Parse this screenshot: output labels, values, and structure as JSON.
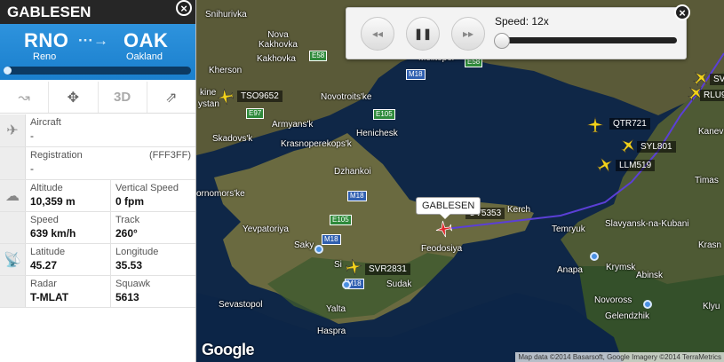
{
  "flight": {
    "callsign": "GABLESEN",
    "origin_code": "RNO",
    "origin_city": "Reno",
    "destination_code": "OAK",
    "destination_city": "Oakland",
    "progress_fraction": 0.02
  },
  "toolbar": {
    "three_d_label": "3D"
  },
  "details": {
    "aircraft_label": "Aircraft",
    "aircraft_value": "-",
    "registration_label": "Registration",
    "registration_code": "(FFF3FF)",
    "registration_value": "-",
    "altitude_label": "Altitude",
    "altitude_value": "10,359 m",
    "vspeed_label": "Vertical Speed",
    "vspeed_value": "0 fpm",
    "speed_label": "Speed",
    "speed_value": "639 km/h",
    "track_label": "Track",
    "track_value": "260°",
    "latitude_label": "Latitude",
    "latitude_value": "45.27",
    "longitude_label": "Longitude",
    "longitude_value": "35.53",
    "radar_label": "Radar",
    "radar_value": "T-MLAT",
    "squawk_label": "Squawk",
    "squawk_value": "5613"
  },
  "playback": {
    "speed_label": "Speed: 12x"
  },
  "map": {
    "callout": "GABLESEN",
    "google": "Google",
    "credit": "Map data ©2014 Basarsoft, Google Imagery ©2014 TerraMetrics",
    "places": {
      "snihurivka": "Snihurivka",
      "nova_kakhovka": "Nova\nKakhovka",
      "kakhovka": "Kakhovka",
      "kherson": "Kherson",
      "melitopol": "Melitopol'",
      "novotroitske": "Novotroits'ke",
      "armyansk": "Armyans'k",
      "henichesk": "Henichesk",
      "krasnoperekopsk": "Krasnoperekops'k",
      "skadovsk": "Skadovs'k",
      "dzhankoi": "Dzhankoi",
      "chornomorske": "ornomors'ke",
      "yevpatoriya": "Yevpatoriya",
      "saky": "Saky",
      "simferopol": "Si",
      "feodosiya": "Feodosiya",
      "sudak": "Sudak",
      "sevastopol": "Sevastopol",
      "yalta": "Yalta",
      "haspra": "Haspra",
      "kerch": "Kerch",
      "temryuk": "Temryuk",
      "slavyansk": "Slavyansk-na-Kubani",
      "anapa": "Anapa",
      "krymsk": "Krymsk",
      "abinsk": "Abinsk",
      "novoross": "Novoross",
      "gelendzhik": "Gelendzhik",
      "krasn": "Krasn",
      "klyu": "Klyu",
      "kanev": "Kanev",
      "timas": "Timas",
      "lenine": "kine",
      "ystan": "ystan"
    },
    "roads": {
      "e58": "E58",
      "e58b": "E58",
      "e97": "E97",
      "e105a": "E105",
      "e105b": "E105",
      "m18a": "M18",
      "m18b": "M18",
      "m18c": "M18",
      "m18d": "M18"
    },
    "planes": {
      "tso": "TSO9652",
      "qtr": "QTR721",
      "syl801": "SYL801",
      "llm": "LLM519",
      "svr": "SVR2831",
      "uv": "UV5353",
      "rlu": "RLU9",
      "sv": "SV"
    }
  }
}
